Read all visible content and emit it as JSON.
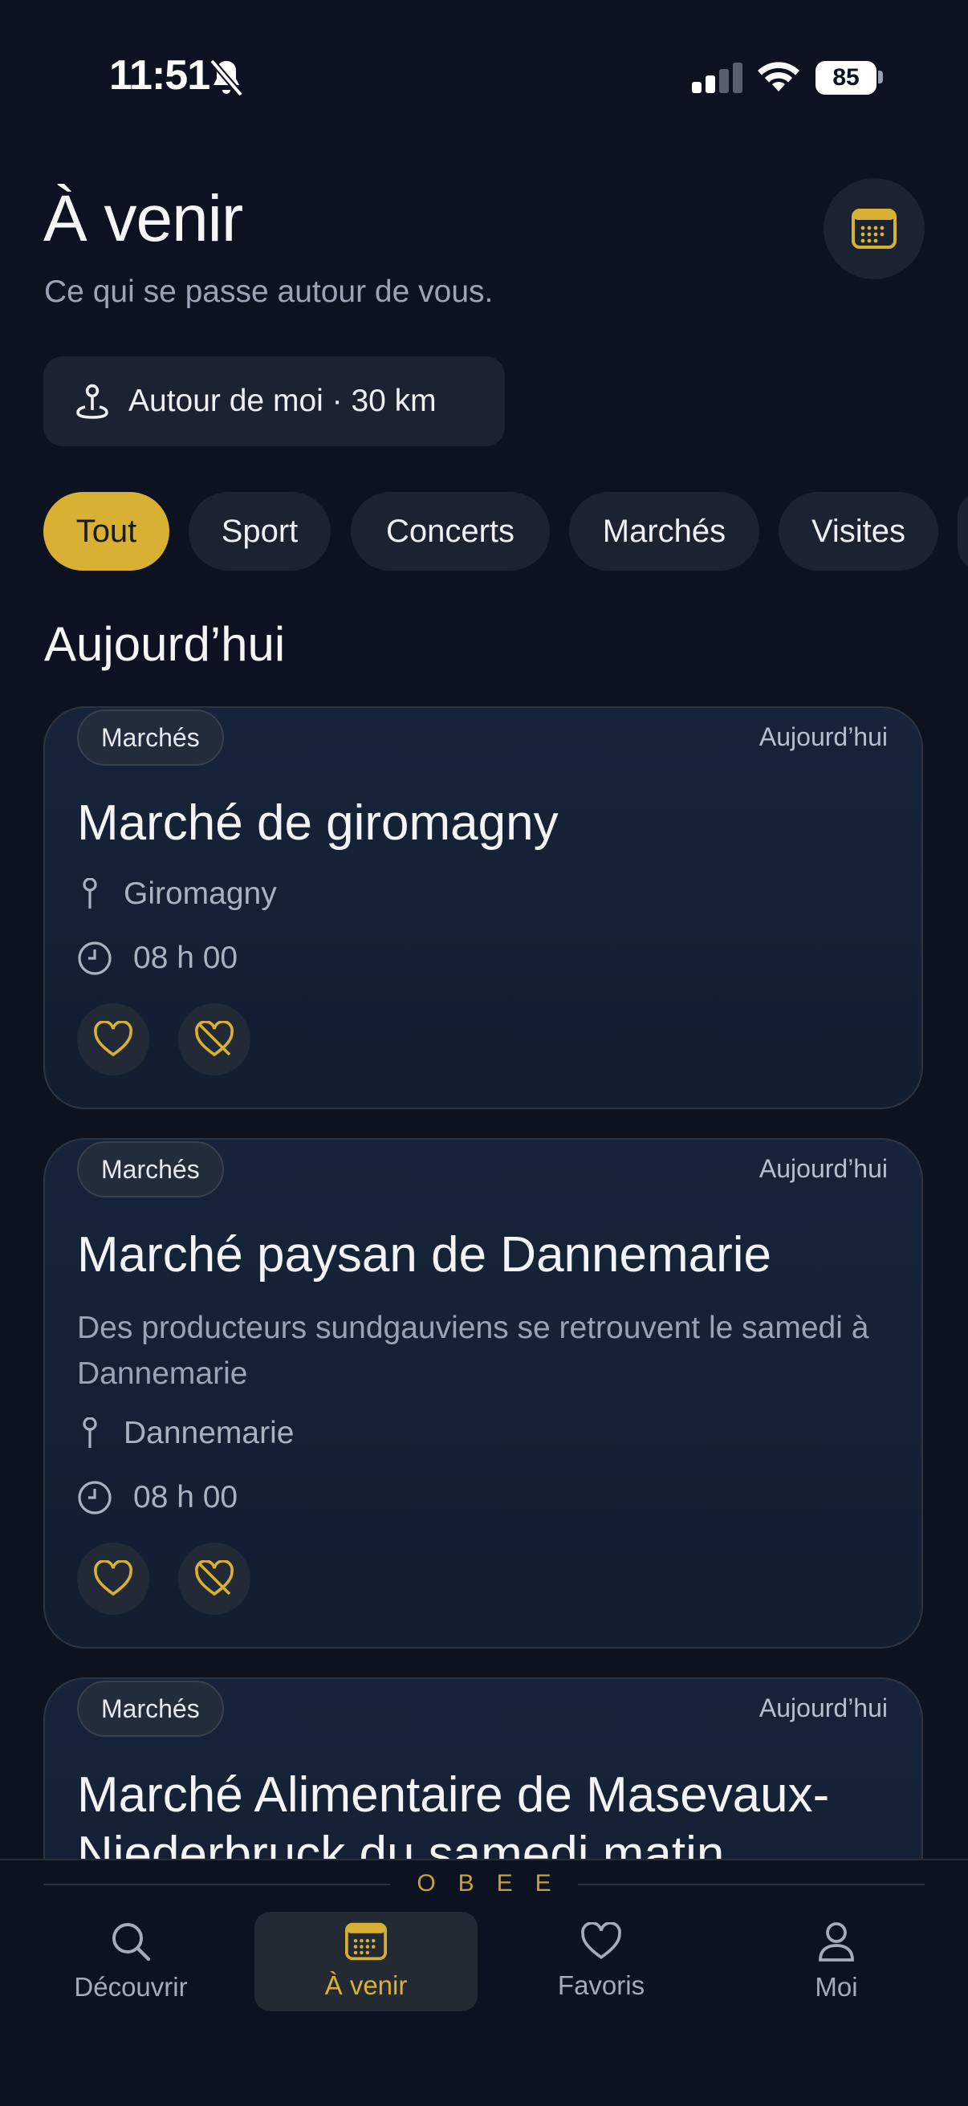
{
  "status_bar": {
    "time": "11:51",
    "battery": "85"
  },
  "header": {
    "title": "À venir",
    "subtitle": "Ce qui se passe autour de vous."
  },
  "location_filter": {
    "label": "Autour de moi · 30 km"
  },
  "filters": [
    {
      "label": "Tout",
      "active": true
    },
    {
      "label": "Sport",
      "active": false
    },
    {
      "label": "Concerts",
      "active": false
    },
    {
      "label": "Marchés",
      "active": false
    },
    {
      "label": "Visites",
      "active": false
    }
  ],
  "section_title": "Aujourd’hui",
  "events": [
    {
      "category": "Marchés",
      "date": "Aujourd’hui",
      "title": "Marché de giromagny",
      "description": "",
      "place": "Giromagny",
      "time": "08 h 00"
    },
    {
      "category": "Marchés",
      "date": "Aujourd’hui",
      "title": "Marché paysan de Dannemarie",
      "description": "Des producteurs sundgauviens se retrouvent le samedi à Dannemarie",
      "place": "Dannemarie",
      "time": "08 h 00"
    },
    {
      "category": "Marchés",
      "date": "Aujourd’hui",
      "title": "Marché Alimentaire de Masevaux-Niederbruck du samedi matin",
      "description": "",
      "place": "",
      "time": ""
    }
  ],
  "brand": "OBEE",
  "nav": [
    {
      "label": "Découvrir",
      "icon": "search-icon",
      "active": false
    },
    {
      "label": "À venir",
      "icon": "calendar-icon",
      "active": true
    },
    {
      "label": "Favoris",
      "icon": "heart-icon",
      "active": false
    },
    {
      "label": "Moi",
      "icon": "person-icon",
      "active": false
    }
  ],
  "colors": {
    "accent": "#d8b134",
    "background": "#0c1220",
    "surface": "#1b2230"
  }
}
